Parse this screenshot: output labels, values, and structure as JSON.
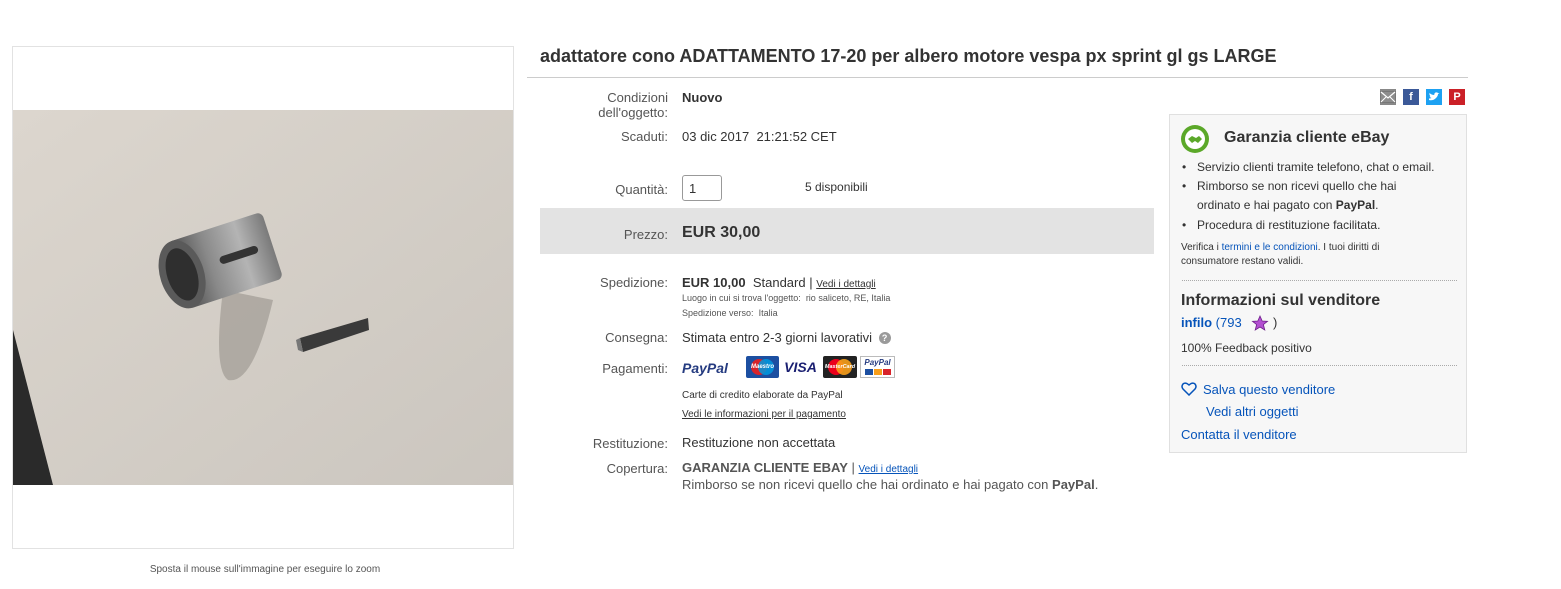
{
  "listing": {
    "title": "adattatore cono ADATTAMENTO 17-20 per albero motore vespa px sprint gl gs LARGE",
    "zoom_hint": "Sposta il mouse sull'immagine per eseguire lo zoom"
  },
  "details": {
    "condition": {
      "label_line1": "Condizioni",
      "label_line2": "dell'oggetto:",
      "value": "Nuovo"
    },
    "ended": {
      "label": "Scaduti:",
      "value": "03 dic 2017  21:21:52 CET"
    },
    "quantity": {
      "label": "Quantità:",
      "value": "1",
      "available": "5 disponibili"
    },
    "price": {
      "label": "Prezzo:",
      "value": "EUR 30,00"
    },
    "shipping": {
      "label": "Spedizione:",
      "cost": "EUR 10,00",
      "service": "Standard |",
      "details_link": "Vedi i dettagli",
      "location_label": "Luogo in cui si trova l'oggetto:",
      "location": "rio saliceto, RE, Italia",
      "to_label": "Spedizione verso:",
      "to": "Italia"
    },
    "delivery": {
      "label": "Consegna:",
      "value": "Stimata entro 2-3 giorni lavorativi",
      "help": "?"
    },
    "payments": {
      "label": "Pagamenti:",
      "paypal": "PayPal",
      "maestro": "Maestro",
      "visa": "VISA",
      "mastercard": "MasterCard",
      "paypal_credit": "PayPal",
      "cards_note": "Carte di credito elaborate da PayPal",
      "info_link": "Vedi le informazioni per il pagamento"
    },
    "returns": {
      "label": "Restituzione:",
      "value": "Restituzione non accettata"
    },
    "coverage": {
      "label": "Copertura:",
      "title": "GARANZIA CLIENTE EBAY",
      "sep": "|",
      "details_link": "Vedi i dettagli",
      "line_prefix": "Rimborso se non ricevi quello che hai ordinato e hai pagato con",
      "line_brand": "PayPal",
      "line_end": "."
    }
  },
  "guarantee": {
    "title": "Garanzia cliente eBay",
    "bullets": [
      "Servizio clienti tramite telefono, chat o email.",
      "Rimborso se non ricevi quello che hai",
      "ordinato e hai pagato con",
      "PayPal",
      ".",
      "Procedura di restituzione facilitata."
    ],
    "verify_prefix": "Verifica i",
    "verify_link": "termini e le condizioni",
    "verify_suffix": ". I tuoi diritti di",
    "verify_line2": "consumatore restano validi."
  },
  "seller": {
    "title": "Informazioni sul venditore",
    "name": "infilo",
    "score_open": "(793",
    "score_close": ")",
    "feedback": "100% Feedback positivo",
    "save": "Salva questo venditore",
    "other_items": "Vedi altri oggetti",
    "contact": "Contatta il venditore"
  },
  "colors": {
    "link": "#0654ba",
    "price_band": "#e3e3e3",
    "guarantee_green": "#5ba829",
    "facebook": "#3b5998",
    "twitter": "#1da1f2",
    "pinterest": "#cb2027"
  },
  "icons": [
    "email-icon",
    "facebook-icon",
    "twitter-icon",
    "pinterest-icon",
    "guarantee-handshake-icon",
    "star-icon",
    "heart-icon",
    "help-icon"
  ]
}
